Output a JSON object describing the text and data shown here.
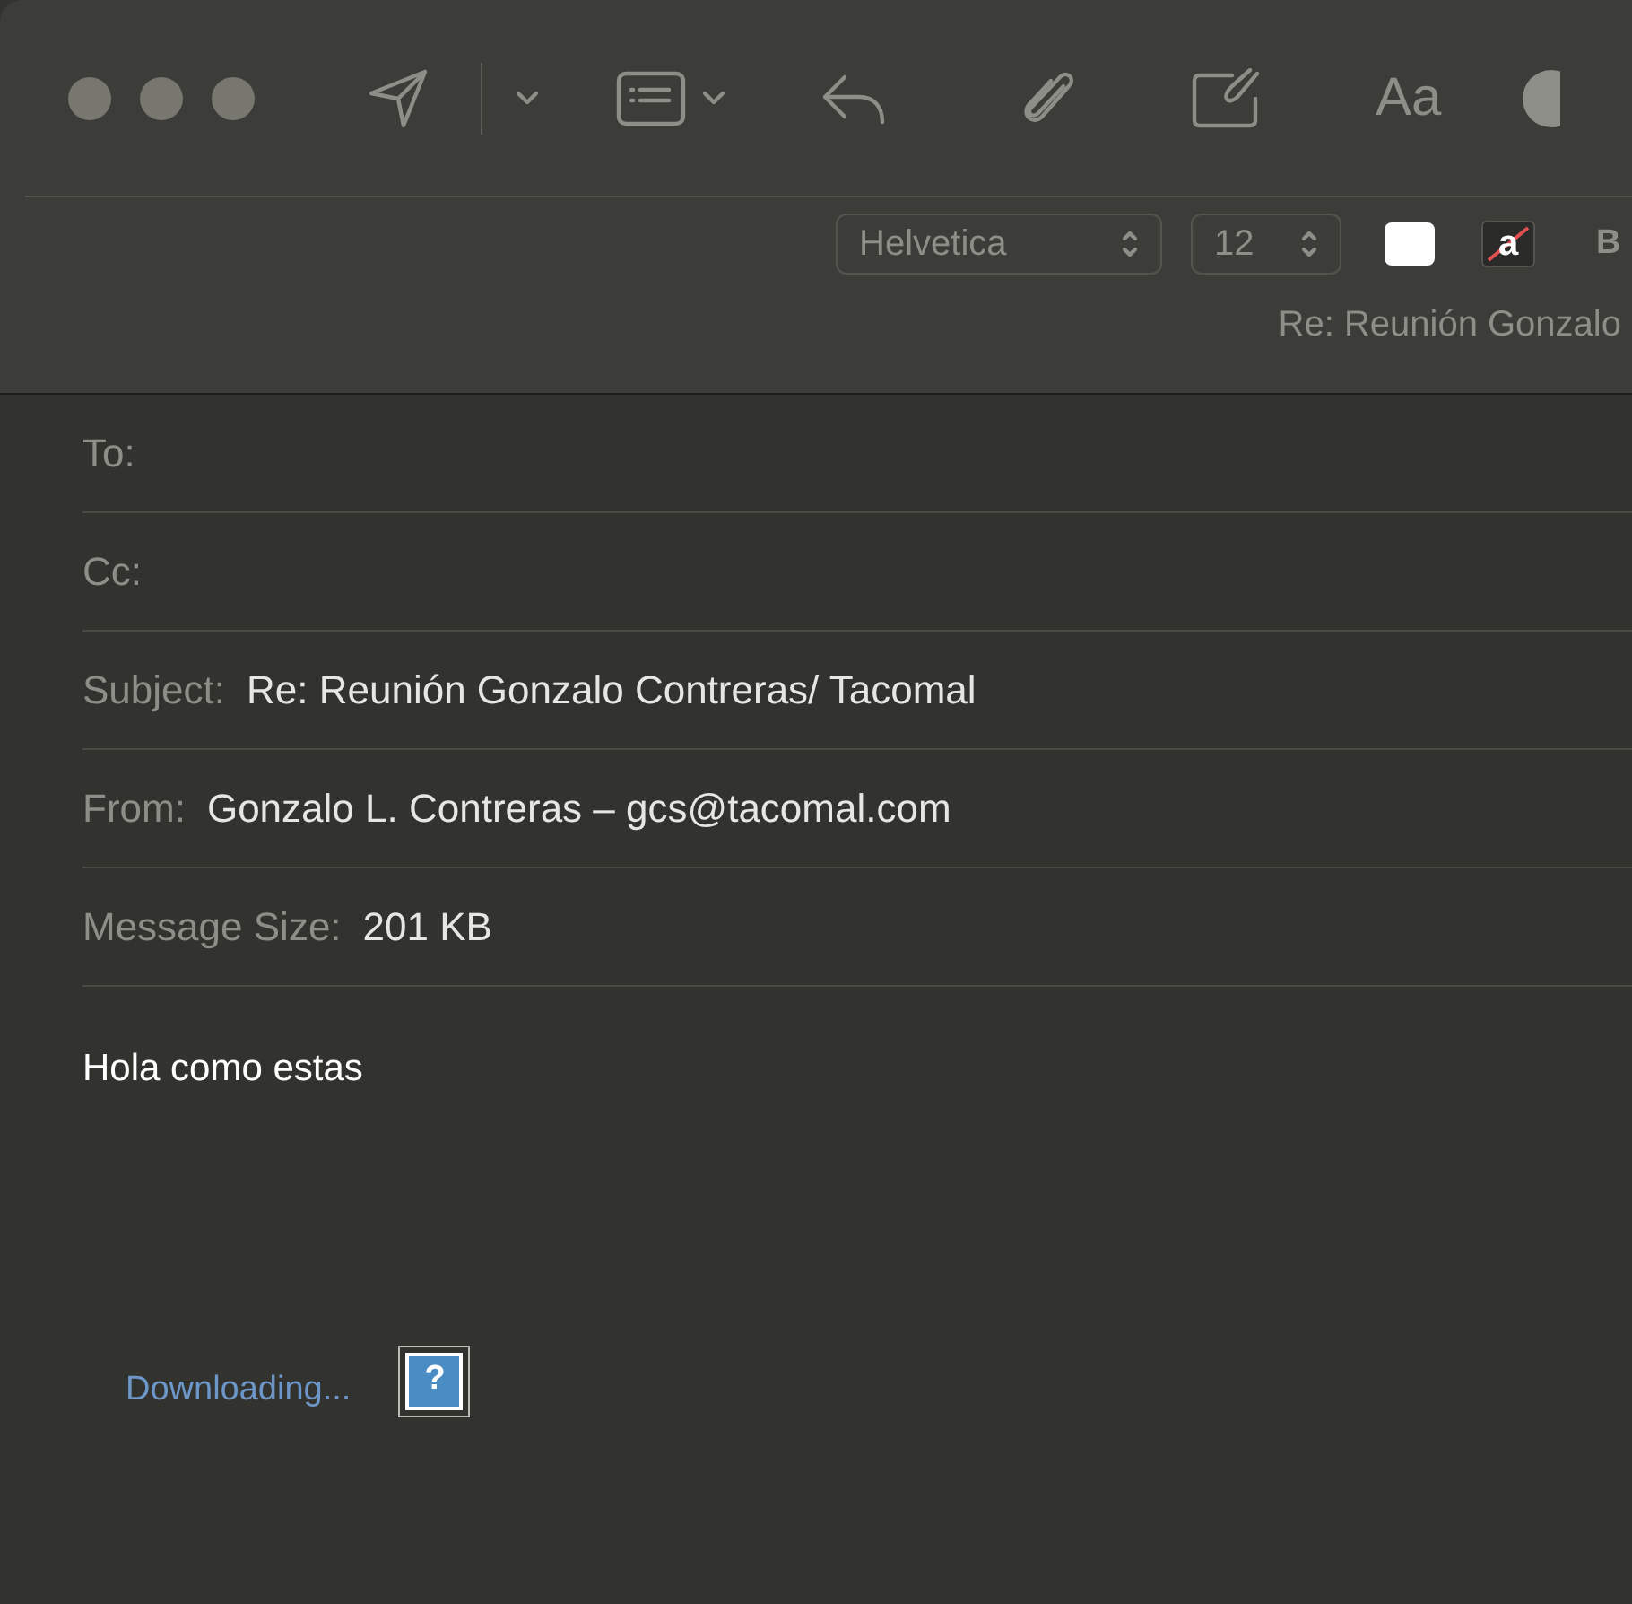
{
  "toolbar": {
    "font": "Helvetica",
    "size": "12",
    "bold": "B",
    "background_color_label": "a",
    "format_label": "Aa"
  },
  "window": {
    "title": "Re: Reunión Gonzalo"
  },
  "headers": [
    {
      "label": "To:"
    },
    {
      "label": "Cc:"
    },
    {
      "label": "Subject:",
      "value": "Re: Reunión Gonzalo Contreras/ Tacomal"
    },
    {
      "label": "From:",
      "value": "Gonzalo L. Contreras – gcs@tacomal.com"
    },
    {
      "label": "Message Size:",
      "value": "201 KB"
    }
  ],
  "body": {
    "text": "Hola como estas",
    "status": "Downloading...",
    "missing_image": "?"
  }
}
